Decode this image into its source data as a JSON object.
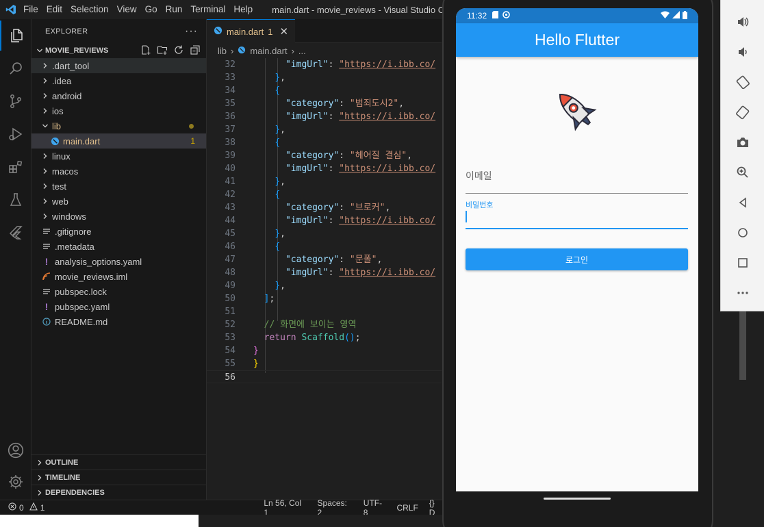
{
  "window": {
    "title": "main.dart - movie_reviews - Visual Studio C",
    "menu": [
      "File",
      "Edit",
      "Selection",
      "View",
      "Go",
      "Run",
      "Terminal",
      "Help"
    ]
  },
  "explorer": {
    "header": "EXPLORER",
    "more": "···",
    "project": "MOVIE_REVIEWS",
    "items": [
      {
        "label": ".dart_tool",
        "type": "folder"
      },
      {
        "label": ".idea",
        "type": "folder"
      },
      {
        "label": "android",
        "type": "folder"
      },
      {
        "label": "ios",
        "type": "folder"
      },
      {
        "label": "lib",
        "type": "folder-open"
      },
      {
        "label": "main.dart",
        "type": "dart",
        "badge": "1"
      },
      {
        "label": "linux",
        "type": "folder"
      },
      {
        "label": "macos",
        "type": "folder"
      },
      {
        "label": "test",
        "type": "folder"
      },
      {
        "label": "web",
        "type": "folder"
      },
      {
        "label": "windows",
        "type": "folder"
      },
      {
        "label": ".gitignore",
        "type": "file"
      },
      {
        "label": ".metadata",
        "type": "file"
      },
      {
        "label": "analysis_options.yaml",
        "type": "yaml"
      },
      {
        "label": "movie_reviews.iml",
        "type": "iml"
      },
      {
        "label": "pubspec.lock",
        "type": "file"
      },
      {
        "label": "pubspec.yaml",
        "type": "yaml"
      },
      {
        "label": "README.md",
        "type": "info"
      }
    ],
    "bottom_sections": [
      "OUTLINE",
      "TIMELINE",
      "DEPENDENCIES"
    ]
  },
  "editor": {
    "tab_label": "main.dart",
    "tab_badge": "1",
    "breadcrumb": [
      "lib",
      "main.dart",
      "..."
    ],
    "line_numbers": [
      "32",
      "33",
      "34",
      "35",
      "36",
      "37",
      "38",
      "39",
      "40",
      "41",
      "42",
      "43",
      "44",
      "45",
      "46",
      "47",
      "48",
      "49",
      "50",
      "51",
      "52",
      "53",
      "54",
      "55",
      "56"
    ],
    "strings": {
      "category_key": "\"category\"",
      "imgurl_key": "\"imgUrl\"",
      "url": "\"https://i.ibb.co/",
      "cat1": "\"범죄도시2\"",
      "cat2": "\"헤어질 결심\"",
      "cat3": "\"브로커\"",
      "cat4": "\"문폴\"",
      "comment": "// 화면에 보이는 영역",
      "return_kw": "return",
      "scaffold": "Scaffold"
    }
  },
  "statusbar": {
    "errors": "0",
    "warnings": "1",
    "position": "Ln 56, Col 1",
    "spaces": "Spaces: 2",
    "encoding": "UTF-8",
    "eol": "CRLF",
    "lang": "{} D"
  },
  "phone": {
    "time": "11:32",
    "appbar_title": "Hello Flutter",
    "email_placeholder": "이메일",
    "password_label": "비밀번호",
    "login_button": "로그인"
  },
  "colors": {
    "accent": "#2196f3",
    "vscode_blue": "#0078d4",
    "modified": "#e2c08d"
  }
}
